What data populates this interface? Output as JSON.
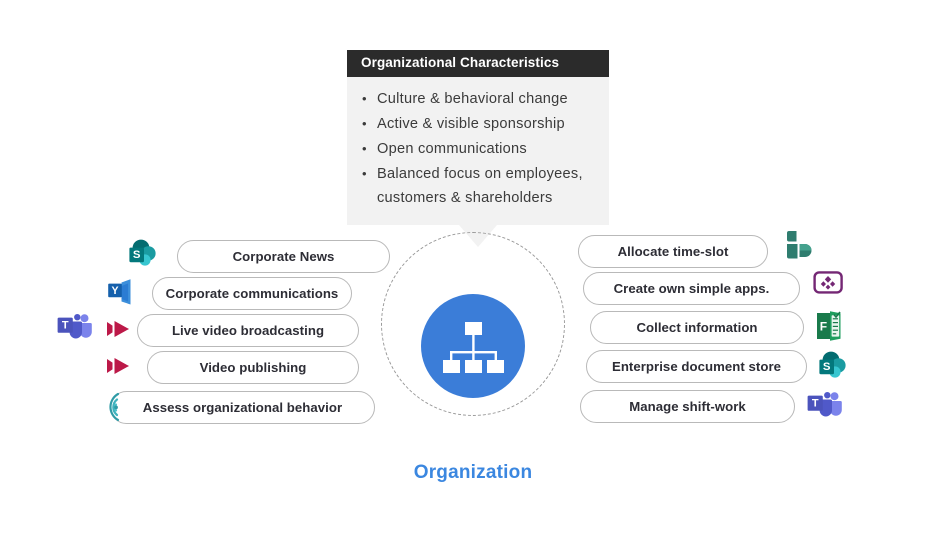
{
  "callout": {
    "title": "Organizational Characteristics",
    "bullets": [
      "Culture & behavioral change",
      "Active & visible sponsorship",
      "Open communications",
      "Balanced focus on employees, customers & shareholders"
    ]
  },
  "hub": {
    "label": "Organization",
    "icon": "org-chart-icon",
    "color": "#3b7dd8",
    "label_color": "#3b87e0"
  },
  "left_items": [
    {
      "label": "Corporate News",
      "icon": "sharepoint-icon"
    },
    {
      "label": "Corporate communications",
      "icon": "yammer-icon"
    },
    {
      "label": "Live video broadcasting",
      "icon": "teams-icon, stream-icon"
    },
    {
      "label": "Video publishing",
      "icon": "stream-icon"
    },
    {
      "label": "Assess organizational behavior",
      "icon": "viva-insights-icon"
    }
  ],
  "right_items": [
    {
      "label": "Allocate time-slot",
      "icon": "bookings-icon"
    },
    {
      "label": "Create own simple apps.",
      "icon": "power-apps-icon"
    },
    {
      "label": "Collect information",
      "icon": "forms-icon"
    },
    {
      "label": "Enterprise document store",
      "icon": "sharepoint-icon"
    },
    {
      "label": "Manage shift-work",
      "icon": "teams-icon"
    }
  ],
  "colors": {
    "callout_header_bg": "#2b2b2b",
    "callout_body_bg": "#f2f2f2",
    "pill_border": "#b9b9b9",
    "ring": "#9a9a9a",
    "sharepoint": "#036c70",
    "yammer": "#0d6cb8",
    "teams": "#5059c9",
    "stream": "#bc1948",
    "viva_insights": "#2f9ba6",
    "bookings": "#2f7d6f",
    "power_apps": "#742774",
    "forms": "#197a4b"
  }
}
